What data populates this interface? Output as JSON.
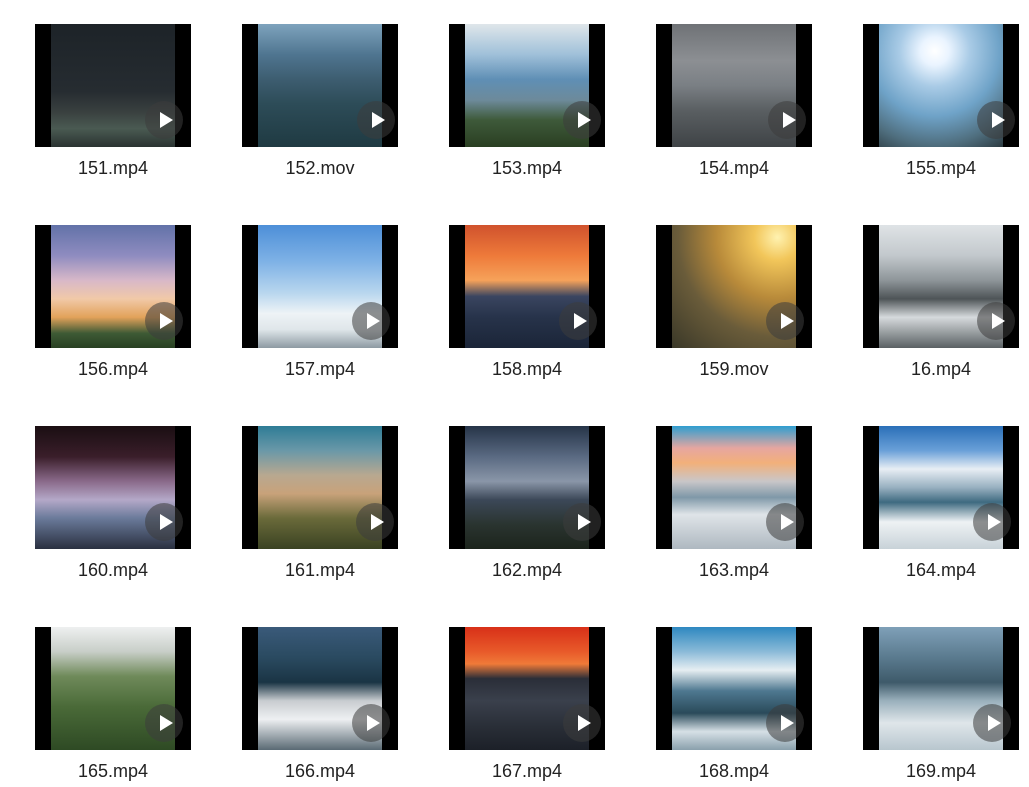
{
  "files": [
    {
      "name": "151.mp4",
      "thumbnail": "starry-night-mountain-fog"
    },
    {
      "name": "152.mov",
      "thumbnail": "blue-mountain-ridges"
    },
    {
      "name": "153.mp4",
      "thumbnail": "clouds-over-green-ridge"
    },
    {
      "name": "154.mp4",
      "thumbnail": "overcast-mountain-valley"
    },
    {
      "name": "155.mp4",
      "thumbnail": "sun-over-snowy-cliff"
    },
    {
      "name": "156.mp4",
      "thumbnail": "pink-sunset-clouds"
    },
    {
      "name": "157.mp4",
      "thumbnail": "blue-sky-sea-of-clouds"
    },
    {
      "name": "158.mp4",
      "thumbnail": "orange-sunset-horizon"
    },
    {
      "name": "159.mov",
      "thumbnail": "golden-hazy-sunrise"
    },
    {
      "name": "16.mp4",
      "thumbnail": "cloud-mountain-peak"
    },
    {
      "name": "160.mp4",
      "thumbnail": "tree-branches-dusk"
    },
    {
      "name": "161.mp4",
      "thumbnail": "misty-grass-slope"
    },
    {
      "name": "162.mp4",
      "thumbnail": "dramatic-clouds-sunrays"
    },
    {
      "name": "163.mp4",
      "thumbnail": "sunset-sea-of-clouds"
    },
    {
      "name": "164.mp4",
      "thumbnail": "blue-sky-cloud-peaks"
    },
    {
      "name": "165.mp4",
      "thumbnail": "green-hills-fog"
    },
    {
      "name": "166.mp4",
      "thumbnail": "cloud-waterfall-mountain"
    },
    {
      "name": "167.mp4",
      "thumbnail": "red-sunrise-over-clouds"
    },
    {
      "name": "168.mp4",
      "thumbnail": "misty-blue-mountains"
    },
    {
      "name": "169.mp4",
      "thumbnail": "karst-peaks-cloud-sea"
    }
  ]
}
